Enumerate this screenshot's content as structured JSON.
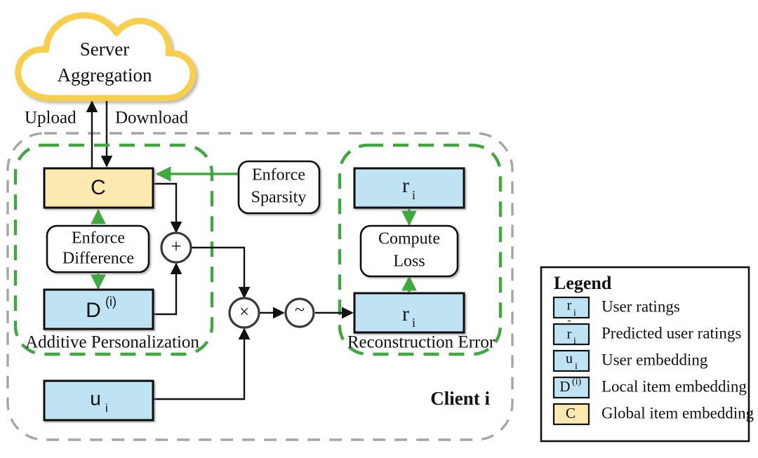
{
  "figure": {
    "title_absent": true,
    "colors": {
      "cloud_outline": "#F7CF4E",
      "box_yellow_fill": "#FCE9B0",
      "box_blue_fill": "#BFE3F2",
      "box_stroke": "#111111",
      "green": "#3FA83F",
      "grey_dashed": "#A6A6A6",
      "background": "#FFFFFF"
    }
  },
  "server": {
    "label_line1": "Server",
    "label_line2": "Aggregation"
  },
  "links": {
    "upload_label": "Upload",
    "download_label": "Download"
  },
  "client": {
    "label": "Client i"
  },
  "groups": {
    "additive": "Additive Personalization",
    "reconstruction": "Reconstruction Error"
  },
  "blocks": {
    "global_item_embedding": "C",
    "enforce_difference_line1": "Enforce",
    "enforce_difference_line2": "Difference",
    "local_item_embedding": "D",
    "local_item_embedding_sup": "(i)",
    "enforce_sparsity_line1": "Enforce",
    "enforce_sparsity_line2": "Sparsity",
    "user_embedding": "u",
    "user_embedding_sub": "i",
    "user_ratings": "r",
    "user_ratings_sub": "i",
    "compute_loss_line1": "Compute",
    "compute_loss_line2": "Loss",
    "predicted_ratings": "r",
    "predicted_ratings_sub": "i"
  },
  "operators": {
    "add": "+",
    "multiply": "×",
    "activation": "~"
  },
  "legend": {
    "title": "Legend",
    "items": [
      {
        "symbol": "r",
        "sub": "i",
        "sup": "",
        "hat": false,
        "fill": "blue",
        "label": "User ratings"
      },
      {
        "symbol": "r",
        "sub": "i",
        "sup": "",
        "hat": true,
        "fill": "blue",
        "label": "Predicted user ratings"
      },
      {
        "symbol": "u",
        "sub": "i",
        "sup": "",
        "hat": false,
        "fill": "blue",
        "label": "User embedding"
      },
      {
        "symbol": "D",
        "sub": "",
        "sup": "(i)",
        "hat": false,
        "fill": "blue",
        "label": "Local item embedding"
      },
      {
        "symbol": "C",
        "sub": "",
        "sup": "",
        "hat": false,
        "fill": "yellow",
        "label": "Global item embedding"
      }
    ]
  }
}
